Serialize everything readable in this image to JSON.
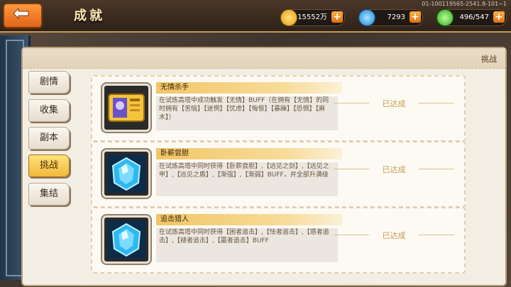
{
  "header": {
    "title": "成就",
    "build": "01-100119565-2541.8-101~1",
    "resources": [
      {
        "name": "gold",
        "value": "15552万",
        "icon": "coin-icon",
        "color": "#f6b21c"
      },
      {
        "name": "diamond",
        "value": "7293",
        "icon": "blue-gem-icon",
        "color": "#2aa8ea"
      },
      {
        "name": "stamina",
        "value": "496/547",
        "icon": "green-gem-icon",
        "color": "#4ed340"
      }
    ]
  },
  "panel": {
    "tag": "挑战"
  },
  "tabs": [
    "剧情",
    "收集",
    "副本",
    "挑战",
    "集结"
  ],
  "active_tab": "挑战",
  "achievements": [
    {
      "name": "无情杀手",
      "desc": "在试炼高塔中成功触发【无情】BUFF（在拥有【无情】的同时拥有【苦恼】【迷惘】【忧虑】【悔恨】【暴躁】【恐惧】【麻木】）",
      "status": "已达成",
      "icon": "ticket-icon"
    },
    {
      "name": "卧薪尝胆",
      "desc": "在试炼高塔中同时获得【卧薪尝胆】,【远见之剑】,【远见之甲】,【远见之盾】,【渐强】,【渐弱】BUFF，并全部升满级",
      "status": "已达成",
      "icon": "crystal-icon"
    },
    {
      "name": "追击猎人",
      "desc": "在试炼高塔中同时获得【困者追击】,【怯者追击】,【惑者追击】,【褪者追击】,【羸者追击】BUFF",
      "status": "已达成",
      "icon": "crystal-icon"
    }
  ]
}
